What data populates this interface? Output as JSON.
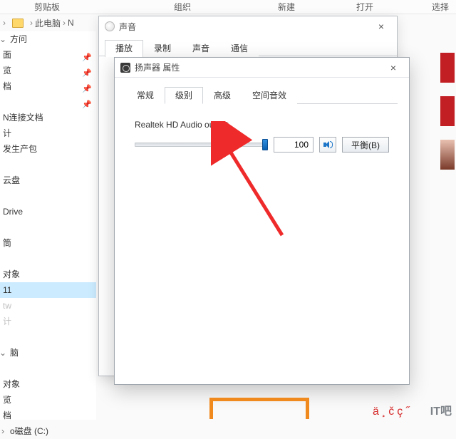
{
  "ribbon": {
    "g1": "剪贴板",
    "g2": "组织",
    "g3": "新建",
    "g4": "打开",
    "g5": "选择"
  },
  "crumb": {
    "root": "此电脑",
    "next": "N"
  },
  "nav": {
    "items": [
      "方问",
      "面",
      "览",
      "档",
      "",
      "N连接文档",
      "计",
      "发生产包",
      "",
      "云盘",
      "",
      "Drive",
      "",
      "筒",
      "",
      "对象",
      "11",
      "tw",
      "计",
      "",
      "脑",
      "",
      "对象",
      "览",
      "档",
      "o磁盘 (C:)"
    ],
    "pin": "📌"
  },
  "soundDlg": {
    "title": "声音",
    "close": "×",
    "tabs": [
      "播放",
      "录制",
      "声音",
      "通信"
    ]
  },
  "propDlg": {
    "title": "扬声器 属性",
    "close": "×",
    "tabs": [
      "常规",
      "级别",
      "高级",
      "空间音效"
    ],
    "device": "Realtek HD Audio output",
    "volume": "100",
    "balance": "平衡(B)"
  },
  "watermark": {
    "a": "ä¸čç˝",
    "b": "IT吧"
  }
}
